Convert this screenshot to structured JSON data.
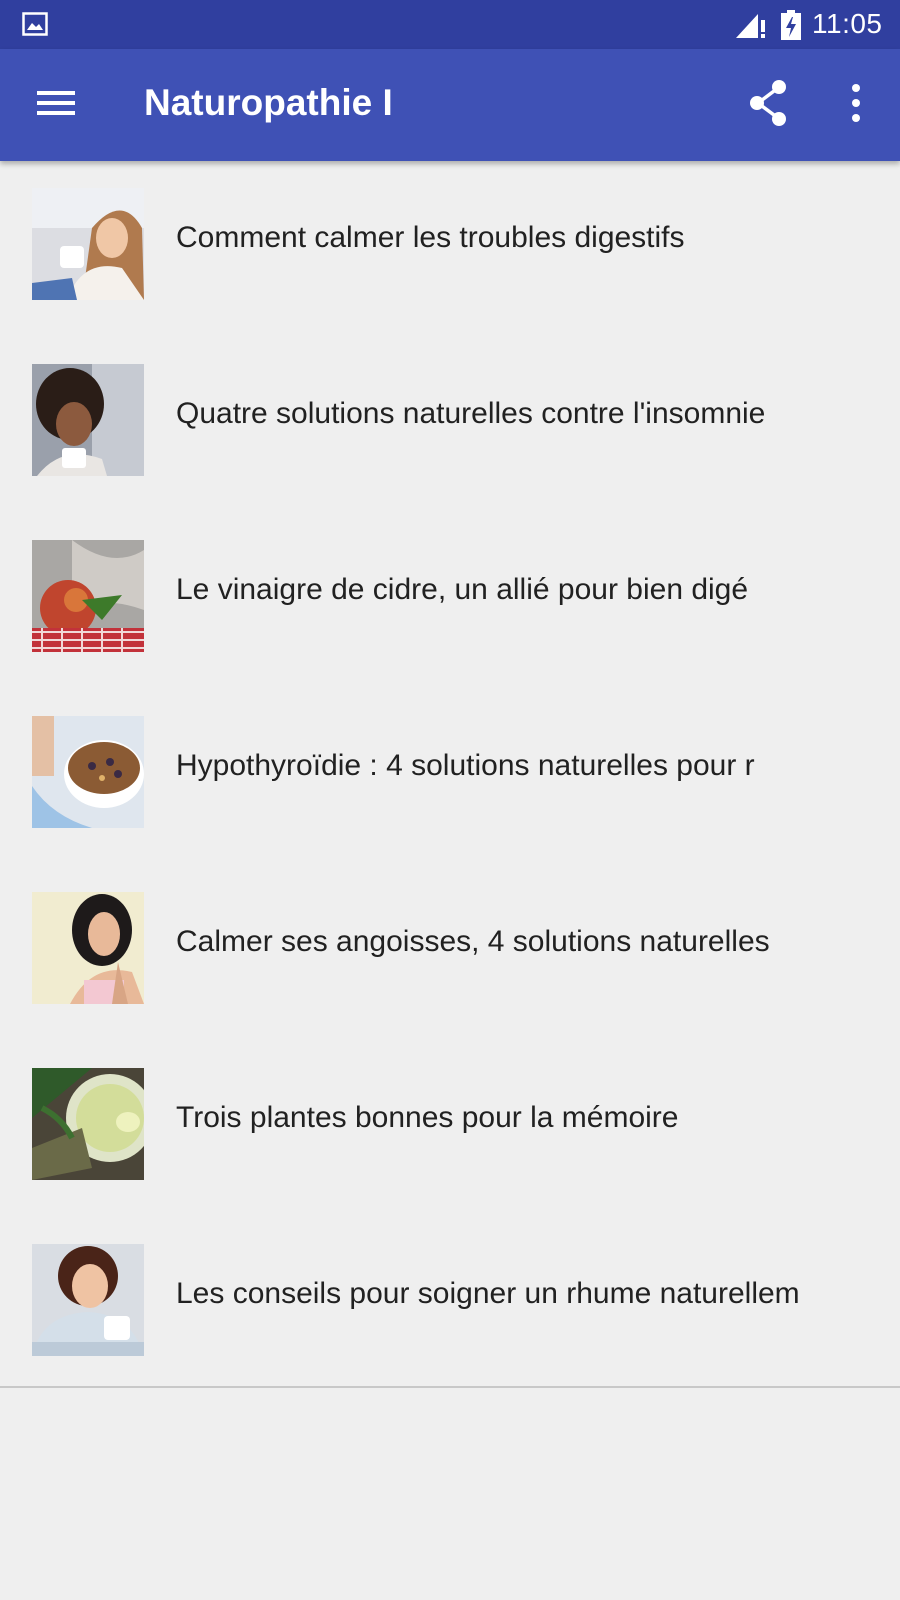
{
  "status_bar": {
    "time": "11:05",
    "icons": [
      "gallery-notification-icon",
      "signal-icon",
      "battery-charging-icon"
    ]
  },
  "app_bar": {
    "title": "Naturopathie I",
    "icons": [
      "menu-icon",
      "share-icon",
      "more-vert-icon"
    ],
    "color": "#3f51b5",
    "status_color": "#303f9f"
  },
  "articles": [
    {
      "title": "Comment calmer les troubles digestifs"
    },
    {
      "title": "Quatre solutions naturelles contre l'insomnie"
    },
    {
      "title": "Le vinaigre de cidre, un allié pour bien digé"
    },
    {
      "title": "Hypothyroïdie : 4 solutions naturelles pour r"
    },
    {
      "title": "Calmer ses angoisses, 4 solutions naturelles"
    },
    {
      "title": "Trois plantes bonnes pour la mémoire"
    },
    {
      "title": "Les conseils pour soigner un rhume naturellem"
    }
  ]
}
